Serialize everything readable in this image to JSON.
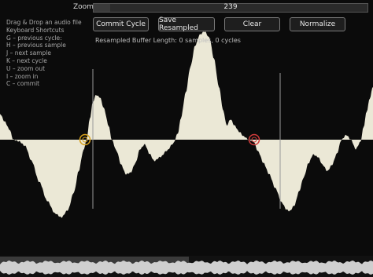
{
  "zoom": {
    "label": "Zoom",
    "value": "239",
    "fill_fraction": 0.06
  },
  "buttons": {
    "commit": "Commit Cycle",
    "save": "Save Resampled",
    "clear": "Clear",
    "normalize": "Normalize"
  },
  "status": {
    "resampled": "Resampled Buffer Length: 0 samples, 0 cycles"
  },
  "help": [
    "Drag & Drop an audio file",
    "Keyboard Shortcuts",
    "G – previous cycle:",
    "H – previous sample",
    "J – next sample",
    "K – next cycle",
    "U – zoom out",
    "I – zoom in",
    "C – commit"
  ],
  "colors": {
    "background": "#0b0b0b",
    "waveform": "#ebe8d6",
    "marker_circle": "#d9a21b",
    "marker_circle_active": "#d23c3c",
    "cursor_line": "#9a9a9a"
  }
}
